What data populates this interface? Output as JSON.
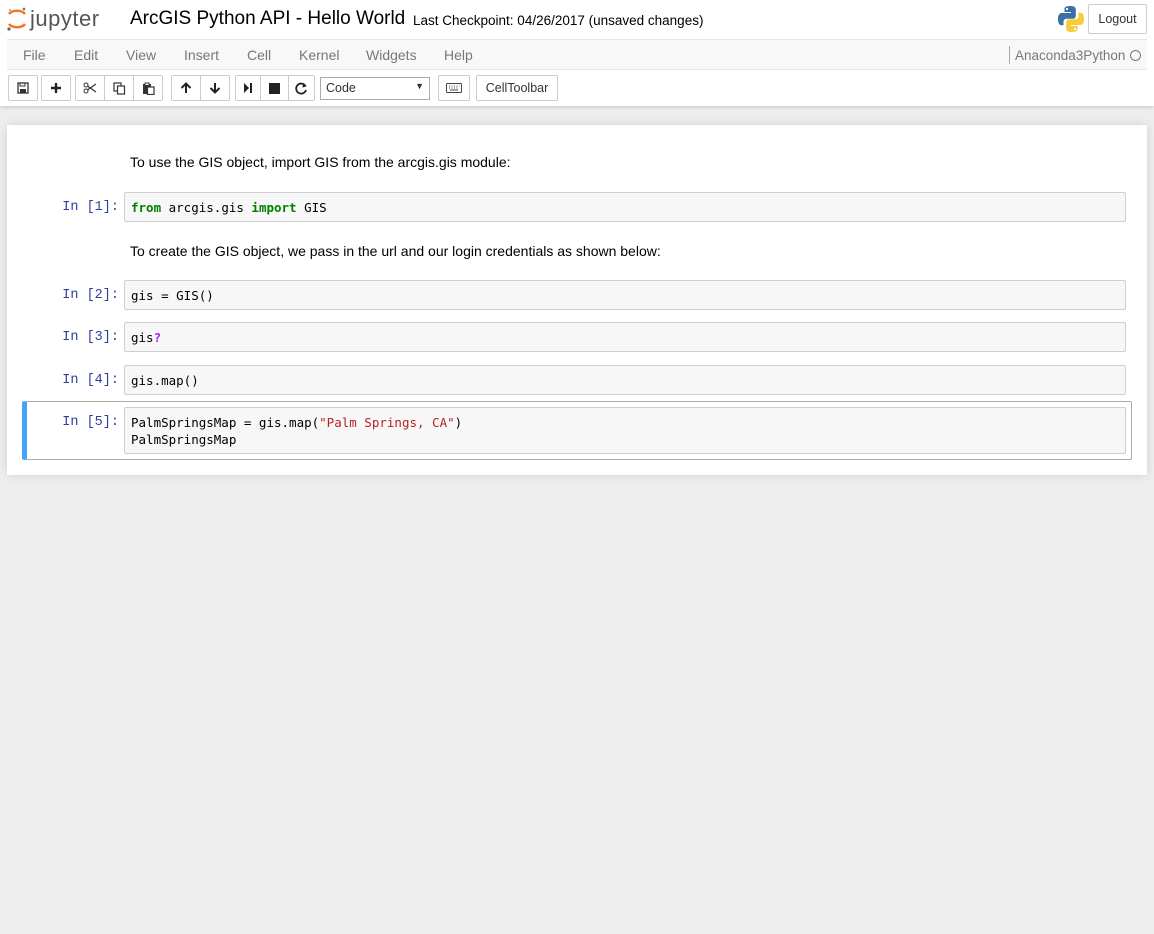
{
  "header": {
    "logo_text": "jupyter",
    "notebook_title": "ArcGIS Python API - Hello World",
    "checkpoint": "Last Checkpoint: 04/26/2017 (unsaved changes)",
    "logout_label": "Logout"
  },
  "menu": {
    "items": [
      "File",
      "Edit",
      "View",
      "Insert",
      "Cell",
      "Kernel",
      "Widgets",
      "Help"
    ],
    "kernel_name": "Anaconda3Python"
  },
  "toolbar": {
    "cell_type": "Code",
    "celltoolbar_label": "CellToolbar",
    "icons": [
      "save-icon",
      "plus-icon",
      "cut-icon",
      "copy-icon",
      "paste-icon",
      "arrow-up-icon",
      "arrow-down-icon",
      "step-forward-icon",
      "stop-icon",
      "refresh-icon",
      "keyboard-icon"
    ]
  },
  "cells": {
    "md1": "To use the GIS object, import GIS from the arcgis.gis module:",
    "md2": "To create the GIS object, we pass in the url and our login credentials as shown below:",
    "c1": {
      "prompt": "In [1]:",
      "kw1": "from",
      "mid": " arcgis.gis ",
      "kw2": "import",
      "end": " GIS"
    },
    "c2": {
      "prompt": "In [2]:",
      "code": "gis = GIS()"
    },
    "c3": {
      "prompt": "In [3]:",
      "code": "gis",
      "op": "?"
    },
    "c4": {
      "prompt": "In [4]:",
      "code": "gis.map()"
    },
    "c5": {
      "prompt": "In [5]:",
      "pre": "PalmSpringsMap = gis.map(",
      "str": "\"Palm Springs, CA\"",
      "post": ")",
      "line2": "PalmSpringsMap"
    }
  }
}
